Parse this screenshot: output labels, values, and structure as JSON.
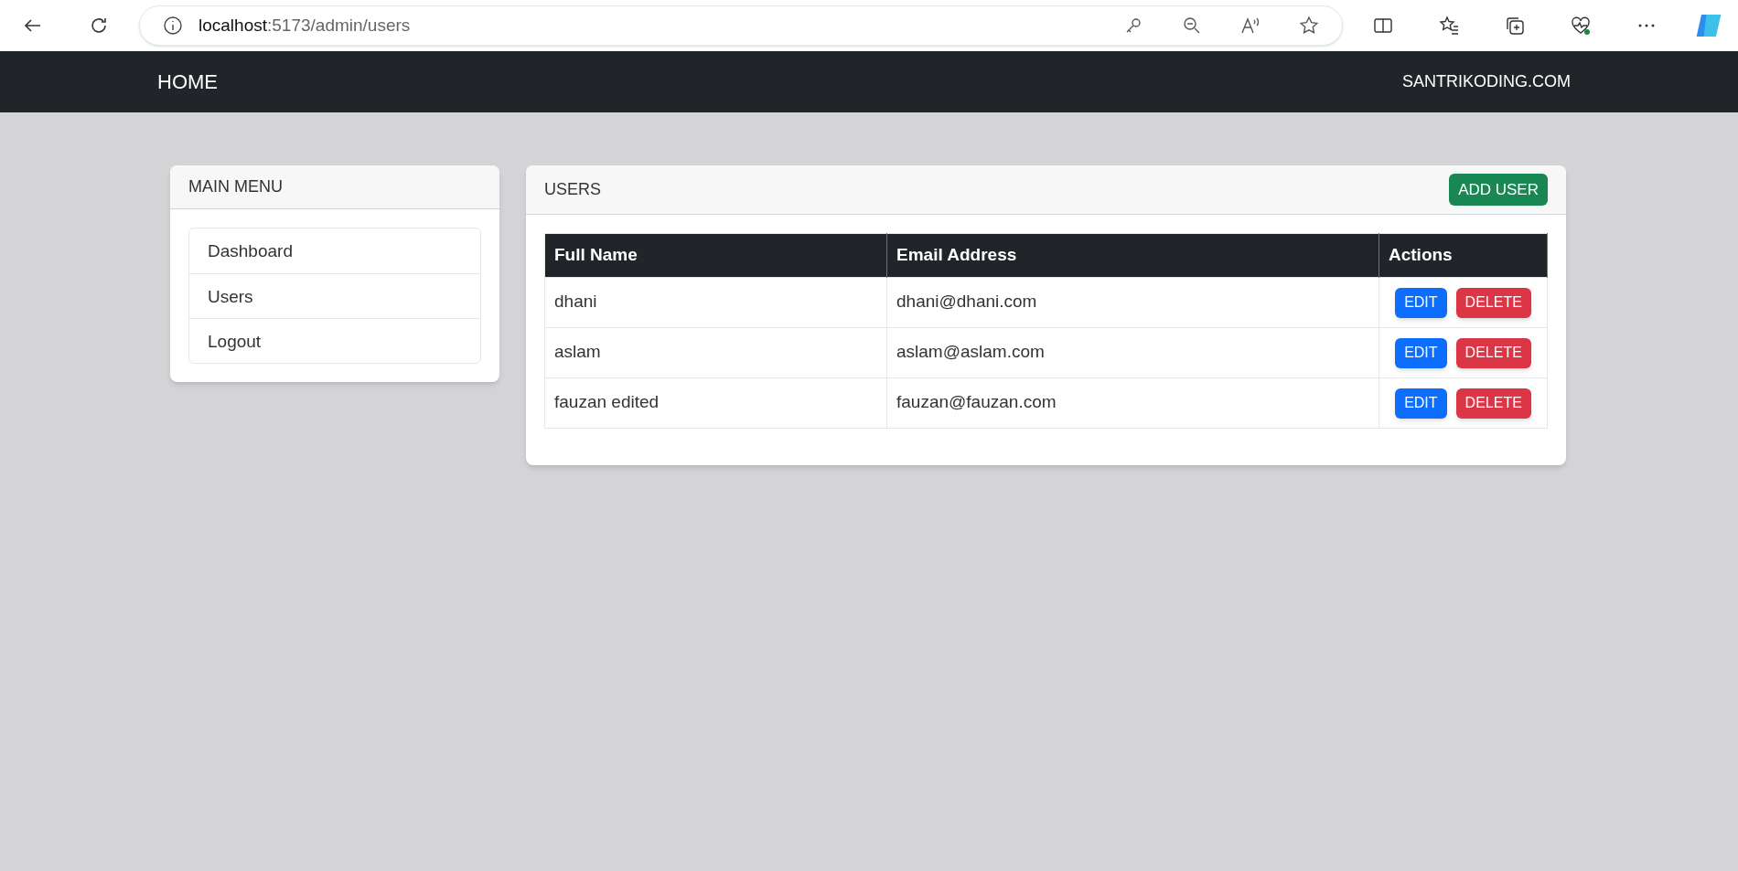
{
  "browser": {
    "url_host": "localhost",
    "url_path": ":5173/admin/users"
  },
  "navbar": {
    "brand": "HOME",
    "right_link": "SANTRIKODING.COM"
  },
  "sidebar": {
    "title": "MAIN MENU",
    "items": [
      {
        "label": "Dashboard"
      },
      {
        "label": "Users"
      },
      {
        "label": "Logout"
      }
    ]
  },
  "users_card": {
    "title": "USERS",
    "add_button": "ADD USER",
    "table": {
      "columns": [
        "Full Name",
        "Email Address",
        "Actions"
      ],
      "rows": [
        {
          "name": "dhani",
          "email": "dhani@dhani.com",
          "edit": "EDIT",
          "delete": "DELETE"
        },
        {
          "name": "aslam",
          "email": "aslam@aslam.com",
          "edit": "EDIT",
          "delete": "DELETE"
        },
        {
          "name": "fauzan edited",
          "email": "fauzan@fauzan.com",
          "edit": "EDIT",
          "delete": "DELETE"
        }
      ]
    }
  }
}
